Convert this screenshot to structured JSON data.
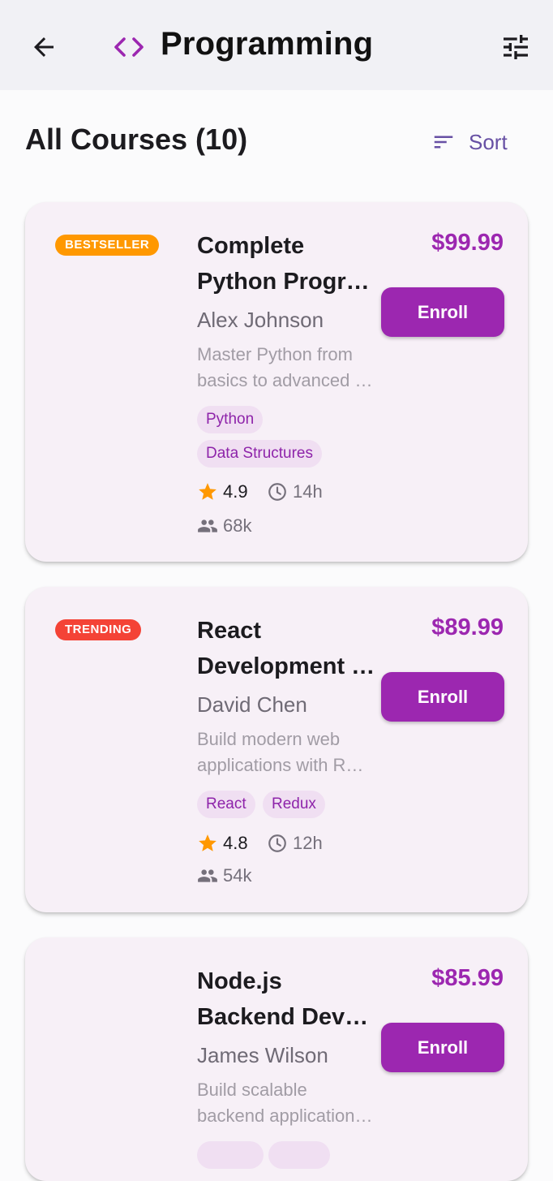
{
  "appbar": {
    "title": "Programming"
  },
  "header": {
    "section_title": "All Courses (10)",
    "sort_label": "Sort"
  },
  "colors": {
    "primary": "#9c27b0",
    "bestseller": "#ff9800",
    "trending": "#f44336",
    "star": "#ff9800"
  },
  "courses": [
    {
      "badge": "BESTSELLER",
      "title_line1": "Complete",
      "title_line2": "Python Progra…",
      "instructor": "Alex Johnson",
      "desc_line1": "Master Python from",
      "desc_line2": "basics to advanced …",
      "tags": [
        "Python",
        "Data Structures"
      ],
      "rating": "4.9",
      "duration": "14h",
      "students": "68k",
      "price": "$99.99",
      "enroll_label": "Enroll"
    },
    {
      "badge": "TRENDING",
      "title_line1": "React",
      "title_line2": "Development …",
      "instructor": "David Chen",
      "desc_line1": "Build modern web",
      "desc_line2": "applications with R…",
      "tags": [
        "React",
        "Redux"
      ],
      "rating": "4.8",
      "duration": "12h",
      "students": "54k",
      "price": "$89.99",
      "enroll_label": "Enroll"
    },
    {
      "badge": "",
      "title_line1": "Node.js",
      "title_line2": "Backend Deve…",
      "instructor": "James Wilson",
      "desc_line1": "Build scalable",
      "desc_line2": "backend application…",
      "price": "$85.99",
      "enroll_label": "Enroll"
    }
  ]
}
